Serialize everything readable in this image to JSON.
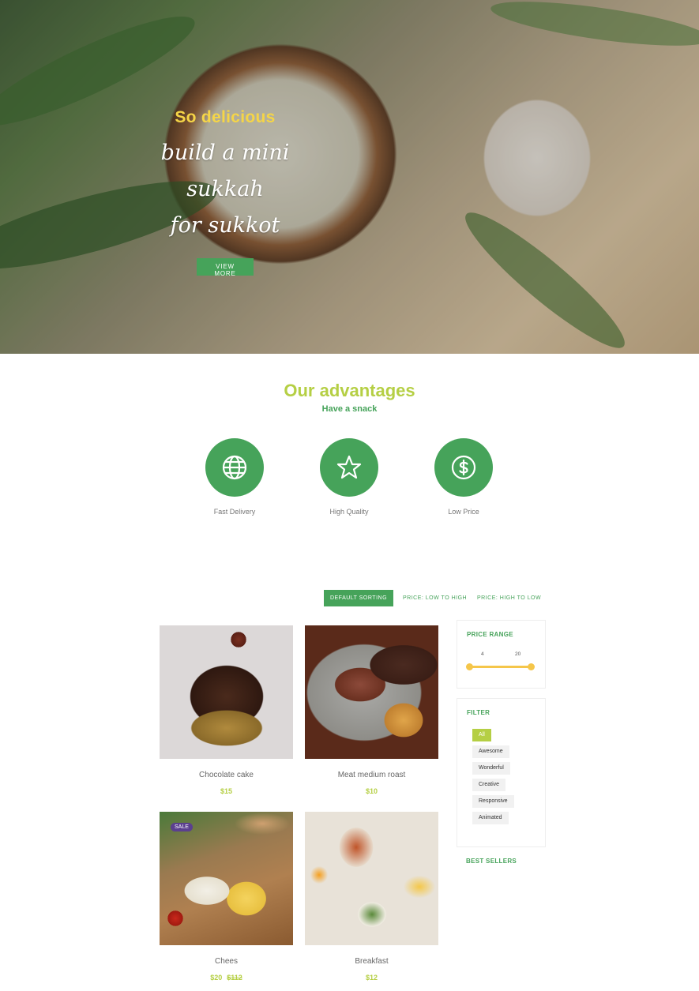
{
  "hero": {
    "kicker": "So delicious",
    "title_line1": "build a mini sukkah",
    "title_line2": "for sukkot",
    "button_label": "VIEW MORE"
  },
  "advantages": {
    "title": "Our advantages",
    "subtitle": "Have a snack",
    "items": [
      {
        "label": "Fast Delivery",
        "icon": "globe-icon"
      },
      {
        "label": "High Quality",
        "icon": "star-icon"
      },
      {
        "label": "Low Price",
        "icon": "dollar-icon"
      }
    ]
  },
  "sorting": {
    "default": "DEFAULT SORTING",
    "low_high": "PRICE: LOW TO HIGH",
    "high_low": "PRICE: HIGH TO LOW"
  },
  "products": [
    {
      "name": "Chocolate cake",
      "price": "$15",
      "old_price": ""
    },
    {
      "name": "Meat medium roast",
      "price": "$10",
      "old_price": ""
    },
    {
      "name": "Chees",
      "price": "$20",
      "old_price": "$112",
      "badge": "SALE"
    },
    {
      "name": "Breakfast",
      "price": "$12",
      "old_price": ""
    }
  ],
  "sidebar": {
    "price_range": {
      "title": "PRICE RANGE",
      "min": "4",
      "max": "20"
    },
    "filter": {
      "title": "FILTER",
      "tags": [
        "All",
        "Awesome",
        "Wonderful",
        "Creative",
        "Responsive",
        "Animated"
      ]
    },
    "best_sellers": "BEST SELLERS"
  },
  "colors": {
    "primary_green": "#46a35a",
    "lime": "#b5cf44",
    "yellow": "#f5d547",
    "range": "#f5c64a",
    "sale_badge": "#5b3f8f"
  }
}
